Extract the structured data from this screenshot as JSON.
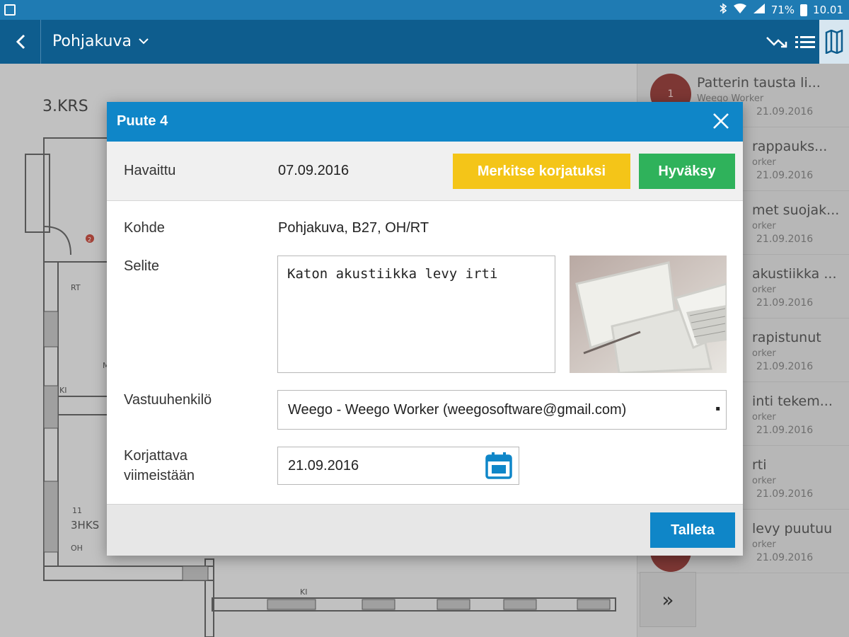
{
  "status_bar": {
    "battery": "71%",
    "time": "10.01",
    "icons": [
      "bluetooth-icon",
      "wifi-icon",
      "signal-icon",
      "battery-icon"
    ]
  },
  "app_bar": {
    "title": "Pohjakuva",
    "icons": [
      "back-icon",
      "chevron-down-icon",
      "trend-icon",
      "list-icon",
      "map-icon"
    ]
  },
  "floor_plan": {
    "title": "3.KRS",
    "labels": [
      "RT",
      "M",
      "KI",
      "11",
      "3HKS",
      "OH",
      "KI"
    ],
    "marker": "2"
  },
  "side_list": {
    "items": [
      {
        "badge": "1",
        "title": "Patterin tausta li...",
        "worker": "Weego Worker",
        "date": "21.09.2016"
      },
      {
        "title": "rappauks...",
        "worker": "orker",
        "date": "21.09.2016"
      },
      {
        "title": "met suojak...",
        "worker": "orker",
        "date": "21.09.2016"
      },
      {
        "title": "akustiikka ...",
        "worker": "orker",
        "date": "21.09.2016"
      },
      {
        "title": "rapistunut",
        "worker": "orker",
        "date": "21.09.2016"
      },
      {
        "title": "inti tekem...",
        "worker": "orker",
        "date": "21.09.2016"
      },
      {
        "title": "rti",
        "worker": "orker",
        "date": "21.09.2016"
      },
      {
        "title": "levy puutuu",
        "worker": "orker",
        "date": "21.09.2016"
      }
    ],
    "more_label": "»"
  },
  "dialog": {
    "title": "Puute 4",
    "close_label": "✕",
    "havaittu_label": "Havaittu",
    "havaittu_value": "07.09.2016",
    "mark_fixed_label": "Merkitse korjatuksi",
    "approve_label": "Hyväksy",
    "kohde_label": "Kohde",
    "kohde_value": "Pohjakuva, B27, OH/RT",
    "selite_label": "Selite",
    "selite_value": "Katon akustiikka levy irti",
    "responsible_label": "Vastuuhenkilö",
    "responsible_value": "Weego - Weego Worker (weegosoftware@gmail.com)",
    "due_label_line1": "Korjattava",
    "due_label_line2": "viimeistään",
    "due_value": "21.09.2016",
    "save_label": "Talleta"
  },
  "colors": {
    "status_bar": "#1f7bb3",
    "app_bar": "#0e5d8e",
    "dialog_header": "#0f86c8",
    "yellow_button": "#f4c518",
    "green_button": "#2fb25b",
    "badge": "#8b2a26"
  }
}
